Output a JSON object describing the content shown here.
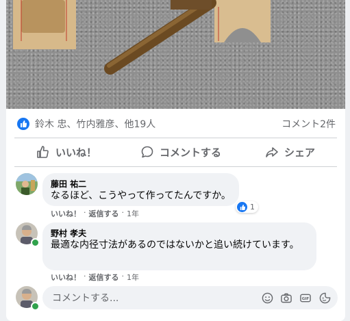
{
  "post": {
    "reactions_summary": "鈴木 忠、竹内雅彦、他19人",
    "comment_count": "コメント2件"
  },
  "actions": {
    "like": "いいね！",
    "comment": "コメントする",
    "share": "シェア"
  },
  "comments": [
    {
      "author": "藤田 祐二",
      "text": "なるほど、こうやって作ってたんですか。",
      "like_label": "いいね！",
      "reply_label": "返信する",
      "time": "1年",
      "reaction_count": "1"
    },
    {
      "author": "野村 孝夫",
      "text": "最適な内径寸法があるのではないかと追い続けています。",
      "like_label": "いいね！",
      "reply_label": "返信する",
      "time": "1年"
    }
  ],
  "composer": {
    "placeholder": "コメントする..."
  },
  "colors": {
    "accent": "#1877f2",
    "online": "#31a24c",
    "bubble": "#f0f2f5",
    "muted": "#65676b"
  }
}
